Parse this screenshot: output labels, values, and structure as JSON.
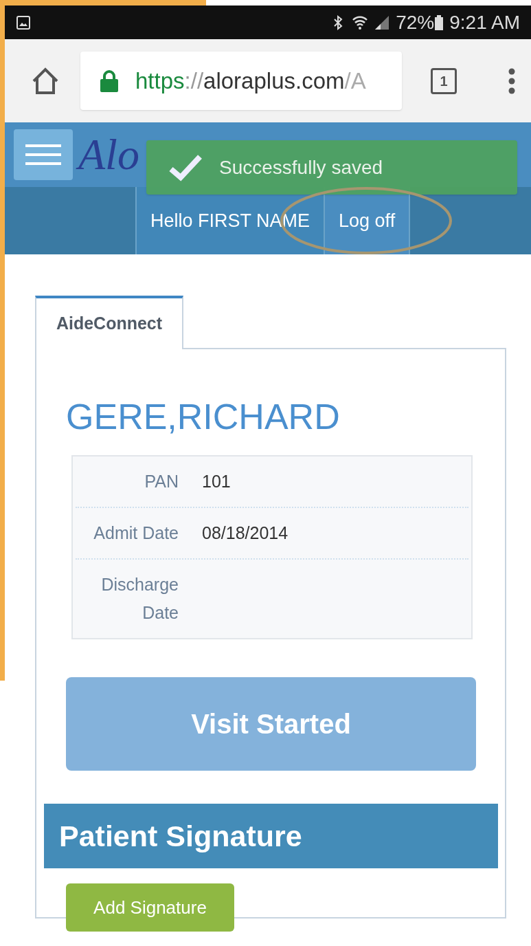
{
  "status_bar": {
    "battery": "72%",
    "time": "9:21 AM"
  },
  "browser": {
    "url": {
      "scheme": "https",
      "separator": "://",
      "host": "aloraplus.com",
      "path": "/A"
    },
    "tab_count": "1"
  },
  "header": {
    "logo": "Alo"
  },
  "toast": {
    "message": "Successfully saved"
  },
  "nav": {
    "greeting": "Hello FIRST NAME",
    "log_off": "Log off"
  },
  "tabs": [
    {
      "label": "AideConnect",
      "selected": true
    }
  ],
  "patient": {
    "name": "GERE,RICHARD",
    "fields": [
      {
        "label": "PAN",
        "value": "101"
      },
      {
        "label": "Admit Date",
        "value": "08/18/2014"
      },
      {
        "label": "Discharge Date"
      }
    ]
  },
  "visit_button": "Visit Started",
  "signature": {
    "heading": "Patient Signature",
    "button": "Add Signature"
  }
}
